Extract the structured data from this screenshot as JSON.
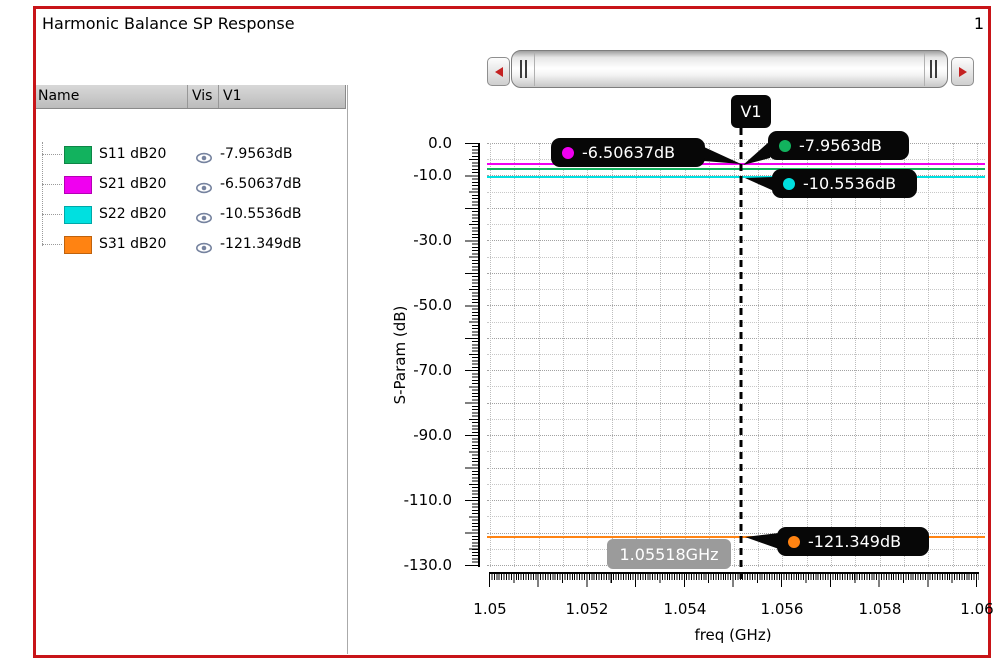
{
  "window": {
    "title": "Harmonic Balance SP Response",
    "page_number": "1"
  },
  "legend": {
    "headers": {
      "name": "Name",
      "vis": "Vis",
      "marker": "V1"
    },
    "rows": [
      {
        "name": "S11 dB20",
        "color": "#12b25e",
        "value": "-7.9563dB"
      },
      {
        "name": "S21 dB20",
        "color": "#f000f0",
        "value": "-6.50637dB"
      },
      {
        "name": "S22 dB20",
        "color": "#00e0e0",
        "value": "-10.5536dB"
      },
      {
        "name": "S31 dB20",
        "color": "#ff8312",
        "value": "-121.349dB"
      }
    ]
  },
  "chart_data": {
    "type": "line",
    "title": "Harmonic Balance SP Response",
    "xlabel": "freq (GHz)",
    "ylabel": "S-Param (dB)",
    "xlim": [
      1.05,
      1.06
    ],
    "ylim": [
      -130,
      0
    ],
    "x_ticks": [
      "1.05",
      "1.052",
      "1.054",
      "1.056",
      "1.058",
      "1.06"
    ],
    "y_ticks": [
      "0.0",
      "-10.0",
      "-30.0",
      "-50.0",
      "-70.0",
      "-90.0",
      "-110.0",
      "-130.0"
    ],
    "grid": "dotted",
    "legend_position": "left-table",
    "series": [
      {
        "name": "S21 dB20",
        "color": "#f000f0",
        "value_db": -6.50637,
        "shape": "flat line across full x range"
      },
      {
        "name": "S11 dB20",
        "color": "#12b25e",
        "value_db": -7.9563,
        "shape": "flat line across full x range"
      },
      {
        "name": "S22 dB20",
        "color": "#00e0e0",
        "value_db": -10.5536,
        "shape": "flat line across full x range"
      },
      {
        "name": "S31 dB20",
        "color": "#ff8312",
        "value_db": -121.349,
        "shape": "flat line across full x range"
      }
    ],
    "marker": {
      "label": "V1",
      "freq_ghz": 1.05518,
      "freq_label": "1.05518GHz",
      "values": [
        {
          "series": "S21 dB20",
          "label": "-6.50637dB",
          "color": "#f000f0"
        },
        {
          "series": "S11 dB20",
          "label": "-7.9563dB",
          "color": "#12b25e"
        },
        {
          "series": "S22 dB20",
          "label": "-10.5536dB",
          "color": "#00e0e0"
        },
        {
          "series": "S31 dB20",
          "label": "-121.349dB",
          "color": "#ff8312"
        }
      ]
    }
  }
}
